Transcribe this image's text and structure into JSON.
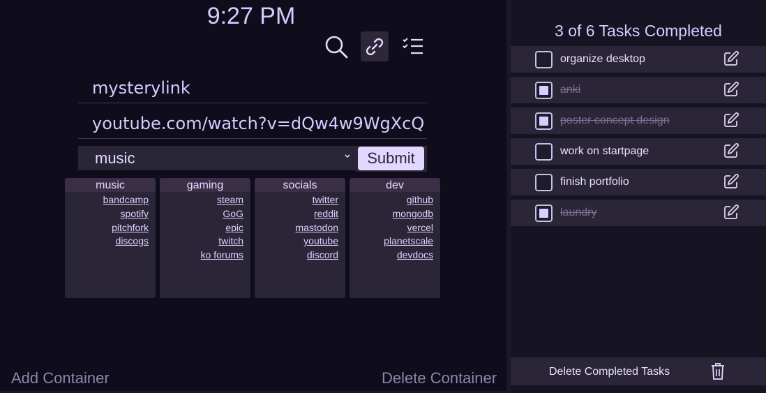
{
  "clock": {
    "time": "9:27 PM"
  },
  "modes": {
    "search_icon": "search-icon",
    "link_icon": "link-icon",
    "tasks_icon": "checklist-icon",
    "active": "link"
  },
  "link_form": {
    "name_value": "mysterylink",
    "url_value": "youtube.com/watch?v=dQw4w9WgXcQ",
    "category_selected": "music",
    "submit_label": "Submit"
  },
  "containers": [
    {
      "title": "music",
      "links": [
        "bandcamp",
        "spotify",
        "pitchfork",
        "discogs"
      ]
    },
    {
      "title": "gaming",
      "links": [
        "steam",
        "GoG",
        "epic",
        "twitch",
        "ko forums"
      ]
    },
    {
      "title": "socials",
      "links": [
        "twitter",
        "reddit",
        "mastodon",
        "youtube",
        "discord"
      ]
    },
    {
      "title": "dev",
      "links": [
        "github",
        "mongodb",
        "vercel",
        "planetscale",
        "devdocs"
      ]
    }
  ],
  "footer": {
    "add_label": "Add Container",
    "delete_label": "Delete Container"
  },
  "tasks": {
    "title": "3 of 6 Tasks Completed",
    "items": [
      {
        "label": "organize desktop",
        "done": false
      },
      {
        "label": "anki",
        "done": true
      },
      {
        "label": "poster concept design",
        "done": true
      },
      {
        "label": "work on startpage",
        "done": false
      },
      {
        "label": "finish portfolio",
        "done": false
      },
      {
        "label": "laundry",
        "done": true
      }
    ],
    "delete_completed_label": "Delete Completed Tasks"
  },
  "colors": {
    "background": "#0f0c1c",
    "panel": "#2a2637",
    "accent": "#e2d8ff",
    "header": "#3a2f47"
  }
}
